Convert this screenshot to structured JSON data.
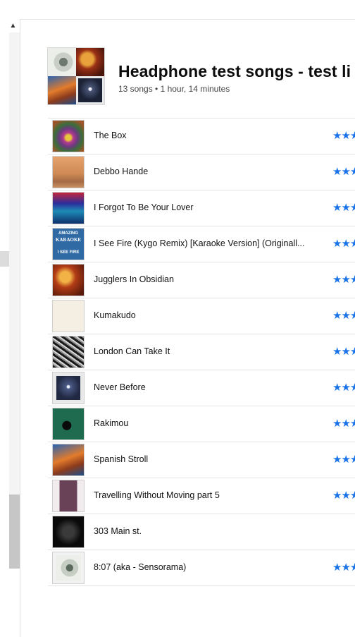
{
  "scrollbar": {
    "up_glyph": "▲"
  },
  "playlist": {
    "title": "Headphone test songs - test li",
    "subtitle": "13 songs • 1 hour, 14 minutes"
  },
  "songs": [
    {
      "title": "The Box",
      "rating": "★★★"
    },
    {
      "title": "Debbo Hande",
      "rating": "★★★"
    },
    {
      "title": "I Forgot To Be Your Lover",
      "rating": "★★★"
    },
    {
      "title": "I See Fire (Kygo  Remix) [Karaoke Version] (Originall...",
      "rating": "★★★"
    },
    {
      "title": "Jugglers In Obsidian",
      "rating": "★★★"
    },
    {
      "title": "Kumakudo",
      "rating": "★★★"
    },
    {
      "title": "London Can Take It",
      "rating": "★★★"
    },
    {
      "title": "Never Before",
      "rating": "★★★"
    },
    {
      "title": "Rakimou",
      "rating": "★★★"
    },
    {
      "title": "Spanish Stroll",
      "rating": "★★★"
    },
    {
      "title": "Travelling Without Moving part 5",
      "rating": "★★★"
    },
    {
      "title": "303 Main st.",
      "rating": ""
    },
    {
      "title": "8:07 (aka - Sensorama)",
      "rating": "★★★"
    }
  ],
  "karaoke_art": {
    "top": "AMAZING",
    "middle": "KARAOKE",
    "bottom": "I SEE FIRE"
  },
  "colors": {
    "star": "#1a73e8",
    "divider": "#e3e3e3"
  }
}
